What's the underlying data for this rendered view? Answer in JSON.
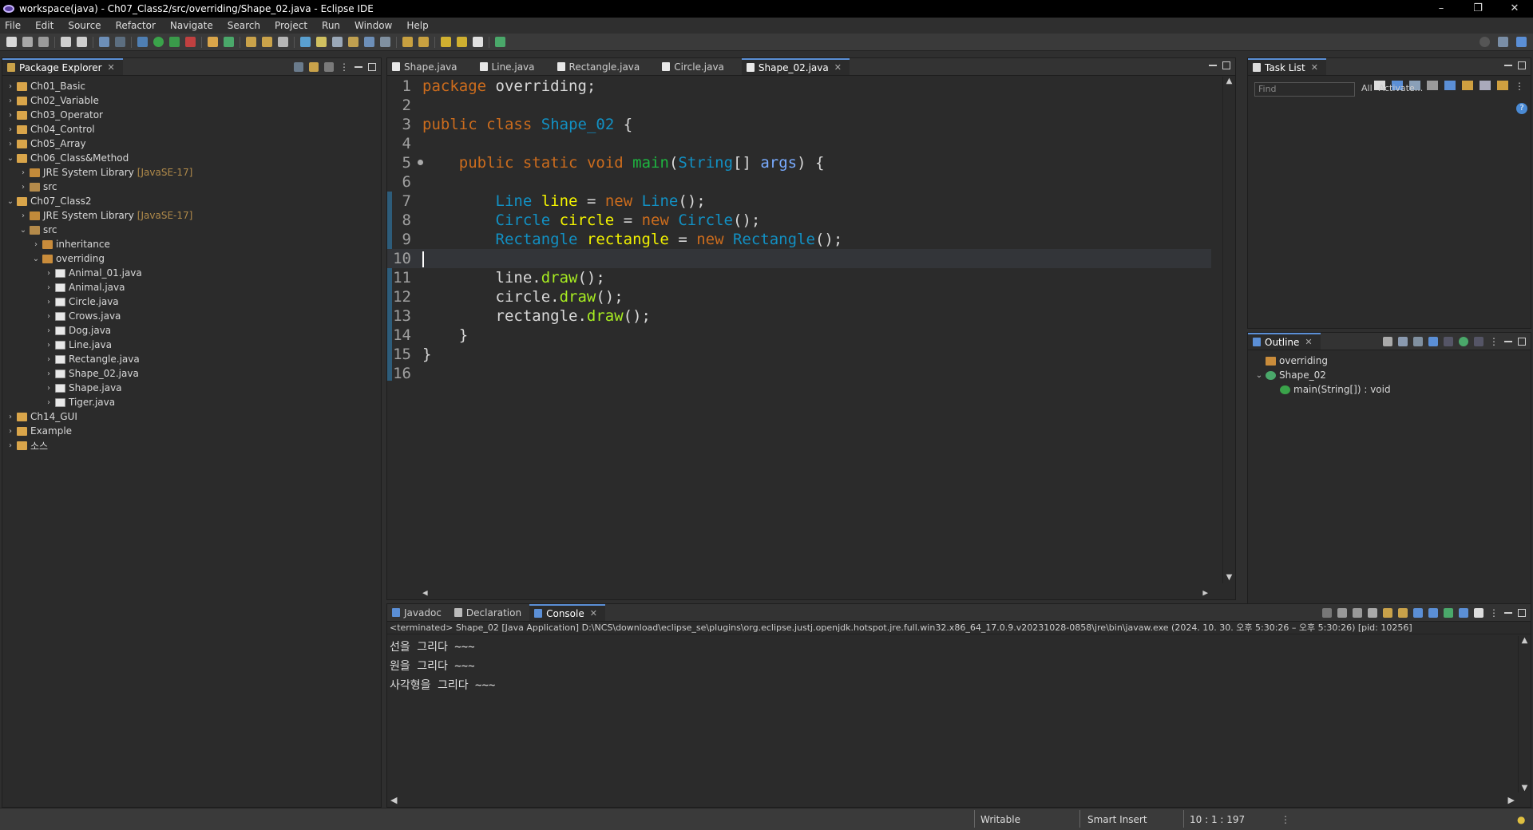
{
  "window": {
    "title": "workspace(java) - Ch07_Class2/src/overriding/Shape_02.java - Eclipse IDE"
  },
  "menu": [
    "File",
    "Edit",
    "Source",
    "Refactor",
    "Navigate",
    "Search",
    "Project",
    "Run",
    "Window",
    "Help"
  ],
  "package_explorer": {
    "title": "Package Explorer",
    "items": [
      {
        "label": "Ch01_Basic",
        "level": 0,
        "expand": ">",
        "icon": "proj"
      },
      {
        "label": "Ch02_Variable",
        "level": 0,
        "expand": ">",
        "icon": "proj"
      },
      {
        "label": "Ch03_Operator",
        "level": 0,
        "expand": ">",
        "icon": "proj"
      },
      {
        "label": "Ch04_Control",
        "level": 0,
        "expand": ">",
        "icon": "proj"
      },
      {
        "label": "Ch05_Array",
        "level": 0,
        "expand": ">",
        "icon": "proj"
      },
      {
        "label": "Ch06_Class&Method",
        "level": 0,
        "expand": "v",
        "icon": "proj"
      },
      {
        "label": "JRE System Library",
        "deco": "[JavaSE-17]",
        "level": 1,
        "expand": ">",
        "icon": "jre"
      },
      {
        "label": "src",
        "level": 1,
        "expand": ">",
        "icon": "src"
      },
      {
        "label": "Ch07_Class2",
        "level": 0,
        "expand": "v",
        "icon": "proj"
      },
      {
        "label": "JRE System Library",
        "deco": "[JavaSE-17]",
        "level": 1,
        "expand": ">",
        "icon": "jre"
      },
      {
        "label": "src",
        "level": 1,
        "expand": "v",
        "icon": "src"
      },
      {
        "label": "inheritance",
        "level": 2,
        "expand": ">",
        "icon": "pkg"
      },
      {
        "label": "overriding",
        "level": 2,
        "expand": "v",
        "icon": "pkg"
      },
      {
        "label": "Animal_01.java",
        "level": 3,
        "expand": ">",
        "icon": "java"
      },
      {
        "label": "Animal.java",
        "level": 3,
        "expand": ">",
        "icon": "java"
      },
      {
        "label": "Circle.java",
        "level": 3,
        "expand": ">",
        "icon": "java"
      },
      {
        "label": "Crows.java",
        "level": 3,
        "expand": ">",
        "icon": "java"
      },
      {
        "label": "Dog.java",
        "level": 3,
        "expand": ">",
        "icon": "java"
      },
      {
        "label": "Line.java",
        "level": 3,
        "expand": ">",
        "icon": "java"
      },
      {
        "label": "Rectangle.java",
        "level": 3,
        "expand": ">",
        "icon": "java"
      },
      {
        "label": "Shape_02.java",
        "level": 3,
        "expand": ">",
        "icon": "java"
      },
      {
        "label": "Shape.java",
        "level": 3,
        "expand": ">",
        "icon": "java"
      },
      {
        "label": "Tiger.java",
        "level": 3,
        "expand": ">",
        "icon": "java"
      },
      {
        "label": "Ch14_GUI",
        "level": 0,
        "expand": ">",
        "icon": "proj"
      },
      {
        "label": "Example",
        "level": 0,
        "expand": ">",
        "icon": "proj"
      },
      {
        "label": "소스",
        "level": 0,
        "expand": ">",
        "icon": "proj"
      }
    ]
  },
  "editor": {
    "tabs": [
      {
        "label": "Shape.java",
        "active": false
      },
      {
        "label": "Line.java",
        "active": false
      },
      {
        "label": "Rectangle.java",
        "active": false
      },
      {
        "label": "Circle.java",
        "active": false
      },
      {
        "label": "Shape_02.java",
        "active": true
      }
    ],
    "lines": [
      {
        "n": "1",
        "tokens": [
          [
            "kw",
            "package"
          ],
          [
            "t",
            " overriding;"
          ]
        ]
      },
      {
        "n": "2",
        "tokens": []
      },
      {
        "n": "3",
        "tokens": [
          [
            "kw",
            "public"
          ],
          [
            "t",
            " "
          ],
          [
            "kw",
            "class"
          ],
          [
            "t",
            " "
          ],
          [
            "cls",
            "Shape_02"
          ],
          [
            "t",
            " {"
          ]
        ]
      },
      {
        "n": "4",
        "tokens": []
      },
      {
        "n": "5",
        "fold": true,
        "tokens": [
          [
            "t",
            "    "
          ],
          [
            "kw",
            "public"
          ],
          [
            "t",
            " "
          ],
          [
            "kw",
            "static"
          ],
          [
            "t",
            " "
          ],
          [
            "kw",
            "void"
          ],
          [
            "t",
            " "
          ],
          [
            "meth",
            "main"
          ],
          [
            "t",
            "("
          ],
          [
            "cls",
            "String"
          ],
          [
            "t",
            "[] "
          ],
          [
            "par",
            "args"
          ],
          [
            "t",
            ") {"
          ]
        ]
      },
      {
        "n": "6",
        "tokens": []
      },
      {
        "n": "7",
        "tokens": [
          [
            "t",
            "        "
          ],
          [
            "cls",
            "Line"
          ],
          [
            "t",
            " "
          ],
          [
            "var",
            "line"
          ],
          [
            "t",
            " = "
          ],
          [
            "kw",
            "new"
          ],
          [
            "t",
            " "
          ],
          [
            "cls",
            "Line"
          ],
          [
            "t",
            "();"
          ]
        ]
      },
      {
        "n": "8",
        "tokens": [
          [
            "t",
            "        "
          ],
          [
            "cls",
            "Circle"
          ],
          [
            "t",
            " "
          ],
          [
            "var",
            "circle"
          ],
          [
            "t",
            " = "
          ],
          [
            "kw",
            "new"
          ],
          [
            "t",
            " "
          ],
          [
            "cls",
            "Circle"
          ],
          [
            "t",
            "();"
          ]
        ]
      },
      {
        "n": "9",
        "tokens": [
          [
            "t",
            "        "
          ],
          [
            "cls",
            "Rectangle"
          ],
          [
            "t",
            " "
          ],
          [
            "var",
            "rectangle"
          ],
          [
            "t",
            " = "
          ],
          [
            "kw",
            "new"
          ],
          [
            "t",
            " "
          ],
          [
            "cls",
            "Rectangle"
          ],
          [
            "t",
            "();"
          ]
        ]
      },
      {
        "n": "10",
        "cur": true,
        "tokens": []
      },
      {
        "n": "11",
        "tokens": [
          [
            "t",
            "        line."
          ],
          [
            "mi",
            "draw"
          ],
          [
            "t",
            "();"
          ]
        ]
      },
      {
        "n": "12",
        "tokens": [
          [
            "t",
            "        circle."
          ],
          [
            "mi",
            "draw"
          ],
          [
            "t",
            "();"
          ]
        ]
      },
      {
        "n": "13",
        "tokens": [
          [
            "t",
            "        rectangle."
          ],
          [
            "mi",
            "draw"
          ],
          [
            "t",
            "();"
          ]
        ]
      },
      {
        "n": "14",
        "tokens": [
          [
            "t",
            "    }"
          ]
        ]
      },
      {
        "n": "15",
        "tokens": [
          [
            "t",
            "}"
          ]
        ]
      },
      {
        "n": "16",
        "tokens": []
      }
    ]
  },
  "task_list": {
    "title": "Task List",
    "find_placeholder": "Find",
    "filter_all": "All",
    "filter_activate": "Activate..."
  },
  "outline": {
    "title": "Outline",
    "items": [
      {
        "label": "overriding",
        "level": 0
      },
      {
        "label": "Shape_02",
        "level": 0,
        "expand": "v"
      },
      {
        "label": "main(String[]) : void",
        "level": 1
      }
    ]
  },
  "bottom": {
    "tabs": [
      {
        "label": "Javadoc",
        "active": false
      },
      {
        "label": "Declaration",
        "active": false
      },
      {
        "label": "Console",
        "active": true
      }
    ],
    "console_header": "<terminated> Shape_02 [Java Application] D:\\NCS\\download\\eclipse_se\\plugins\\org.eclipse.justj.openjdk.hotspot.jre.full.win32.x86_64_17.0.9.v20231028-0858\\jre\\bin\\javaw.exe  (2024. 10. 30. 오후 5:30:26 – 오후 5:30:26) [pid: 10256]",
    "output": [
      "선을 그리다 ~~~",
      "원을 그리다 ~~~",
      "사각형을 그리다 ~~~"
    ]
  },
  "status": {
    "writable": "Writable",
    "insert_mode": "Smart Insert",
    "position": "10 : 1 : 197"
  }
}
